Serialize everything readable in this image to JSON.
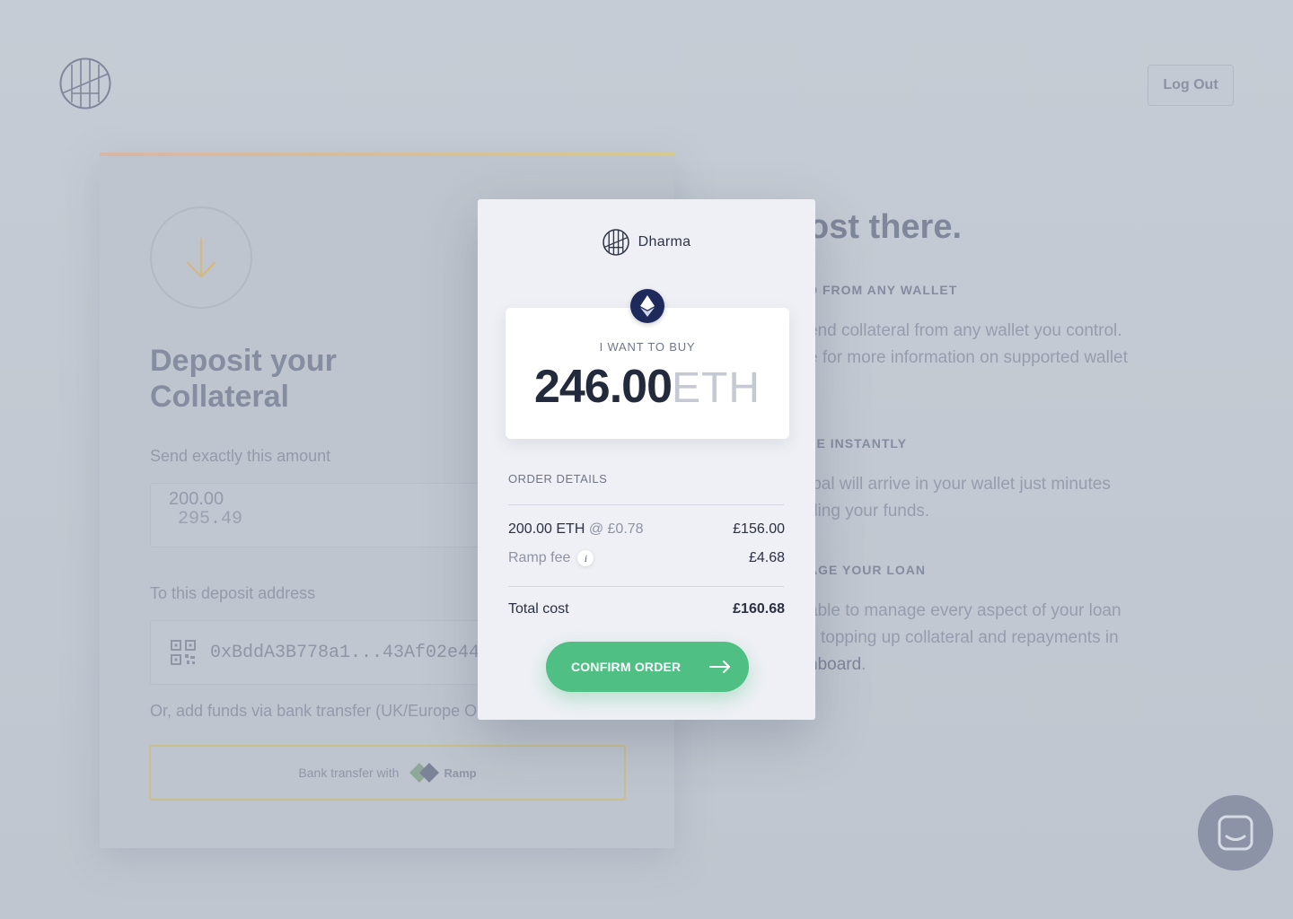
{
  "header": {
    "logout_label": "Log Out"
  },
  "deposit": {
    "title_line1": "Deposit your",
    "title_line2": "Collateral",
    "amount_label": "Send exactly this amount",
    "amount_value": "200.00",
    "amount_value_overlap": "295.49",
    "address_label": "To this deposit address",
    "address_value": "0xBddA3B778a1...43Af02e44",
    "bank_hint": "Or, add funds via bank transfer (UK/Europe On",
    "bank_button_label": "Bank transfer with",
    "ramp_brand": "Ramp"
  },
  "info_panel": {
    "title": "ost there.",
    "sections": [
      {
        "heading": "D FROM ANY WALLET",
        "line1": "end collateral from any wallet you control.",
        "line2": "e for more information on supported wallet"
      },
      {
        "heading": "LE INSTANTLY",
        "line1": "ipal will arrive in your wallet just minutes",
        "line2": "ding your funds."
      },
      {
        "heading": "AGE YOUR LOAN",
        "line1": "able to manage every aspect of your loan",
        "line2": "topping up collateral and repayments in",
        "line3_dark": "nboard",
        "line3_tail": "."
      }
    ]
  },
  "modal": {
    "brand": "Dharma",
    "buy_label": "I WANT TO BUY",
    "buy_amount": "246.00",
    "buy_unit": "ETH",
    "order_details_title": "ORDER DETAILS",
    "rate_row": {
      "left_main": "200.00 ETH",
      "left_rate": "@ £0.78",
      "right": "£156.00"
    },
    "fee_row": {
      "left": "Ramp fee",
      "info": "i",
      "right": "£4.68"
    },
    "total_row": {
      "left": "Total cost",
      "right": "£160.68"
    },
    "confirm_label": "CONFIRM ORDER"
  },
  "icons": {
    "logo": "dharma-logo-icon",
    "arrow_down": "arrow-down-icon",
    "qr": "qr-code-icon",
    "ethereum": "ethereum-icon",
    "arrow_right": "arrow-right-icon",
    "chat": "chat-icon"
  },
  "colors": {
    "confirm_green": "#4fbf84",
    "eth_badge": "#1f2a5c",
    "overlay_bg": "#c2c8d1"
  }
}
